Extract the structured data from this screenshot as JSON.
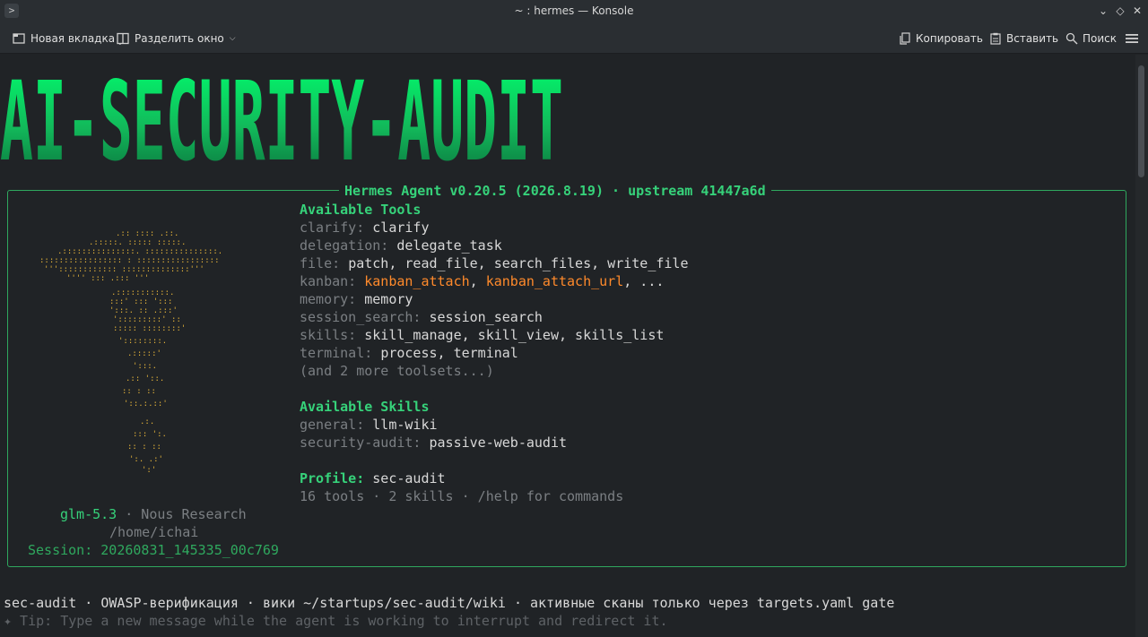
{
  "window": {
    "title": "~ : hermes — Konsole",
    "app_icon_glyph": ">",
    "controls": {
      "minimize": "⌄",
      "maximize": "◇",
      "close": "✕"
    }
  },
  "toolbar": {
    "new_tab": "Новая вкладка",
    "split_view": "Разделить окно",
    "copy": "Копировать",
    "paste": "Вставить",
    "search": "Поиск",
    "caret": "⌄",
    "caret_split": "⌵"
  },
  "banner": {
    "text": "AI-SECURITY-AUDIT",
    "colors": {
      "top": "#00ff6e",
      "bottom": "#0a6b3a"
    }
  },
  "panel": {
    "title": "Hermes Agent v0.20.5 (2026.8.19) · upstream 41447a6d",
    "model": "glm-5.3",
    "provider": " · Nous Research",
    "cwd": "/home/ichai",
    "session": "Session: 20260831_145335_00c769",
    "tools_heading": "Available Tools",
    "tools": [
      {
        "name": "clarify: ",
        "value": "clarify"
      },
      {
        "name": "delegation: ",
        "value": "delegate_task"
      },
      {
        "name": "file: ",
        "value": "patch, read_file, search_files, write_file"
      },
      {
        "name": "kanban: ",
        "value_a": "kanban_attach",
        "sep": ", ",
        "value_b": "kanban_attach_url",
        "tail": ", ..."
      },
      {
        "name": "memory: ",
        "value": "memory"
      },
      {
        "name": "session_search: ",
        "value": "session_search"
      },
      {
        "name": "skills: ",
        "value": "skill_manage, skill_view, skills_list"
      },
      {
        "name": "terminal: ",
        "value": "process, terminal"
      }
    ],
    "tools_more": "(and 2 more toolsets...)",
    "skills_heading": "Available Skills",
    "skills": [
      {
        "name": "general: ",
        "value": "llm-wiki"
      },
      {
        "name": "security-audit: ",
        "value": "passive-web-audit"
      }
    ],
    "profile_label": "Profile:",
    "profile_value": " sec-audit",
    "summary": "16 tools · 2 skills · /help for commands"
  },
  "statusline": "sec-audit · OWASP-верификация · вики ~/startups/sec-audit/wiki · активные сканы только через targets.yaml gate",
  "tip": "✦ Tip: Type a new message while the agent is working to interrupt and redirect it.",
  "colors": {
    "accent": "#36d27a",
    "border": "#2fa85e",
    "orange": "#ff8a2b",
    "gold": "#e2b23a",
    "dim": "#7b7f83"
  }
}
